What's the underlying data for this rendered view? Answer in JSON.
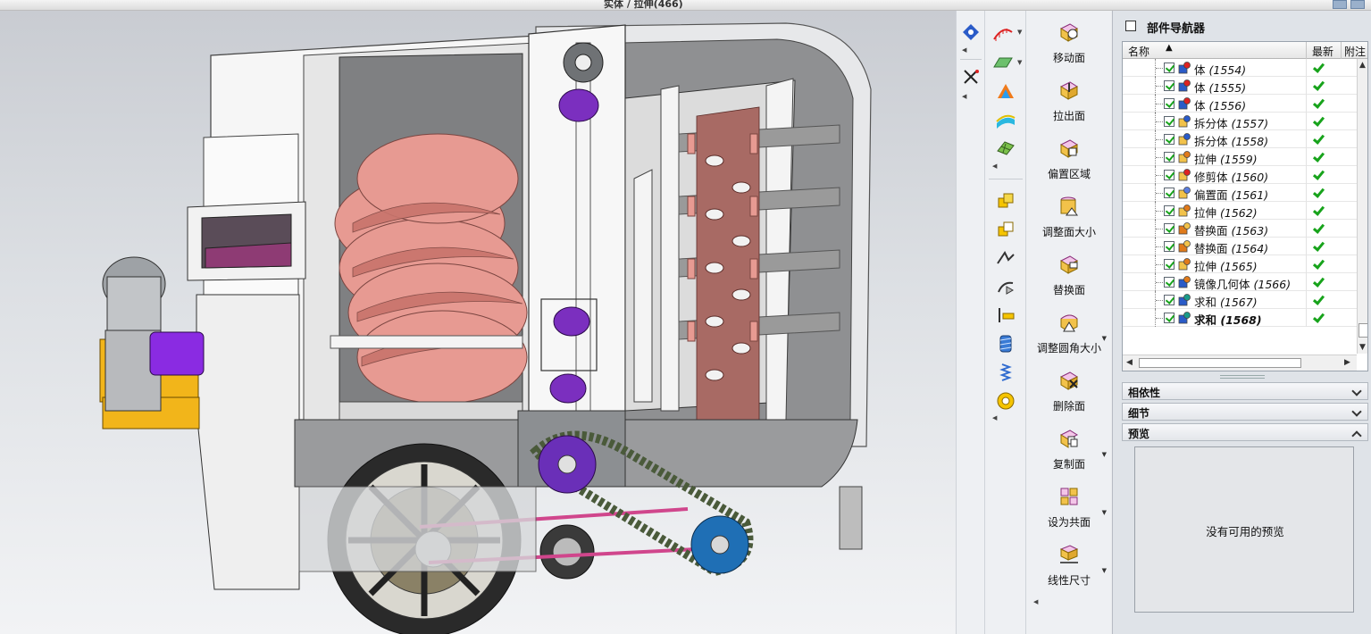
{
  "window": {
    "title": "实体 / 拉伸(466)"
  },
  "commands": [
    {
      "label": "移动面",
      "dropdown": false
    },
    {
      "label": "拉出面",
      "dropdown": false
    },
    {
      "label": "偏置区域",
      "dropdown": false
    },
    {
      "label": "调整面大小",
      "dropdown": false
    },
    {
      "label": "替换面",
      "dropdown": false
    },
    {
      "label": "调整圆角大小",
      "dropdown": true
    },
    {
      "label": "删除面",
      "dropdown": false
    },
    {
      "label": "复制面",
      "dropdown": true
    },
    {
      "label": "设为共面",
      "dropdown": true
    },
    {
      "label": "线性尺寸",
      "dropdown": true
    }
  ],
  "navigator": {
    "title": "部件导航器",
    "columns": {
      "name": "名称",
      "latest": "最新",
      "attach": "附注"
    },
    "rows": [
      {
        "name": "体",
        "id": "(1554)",
        "icon": "body-icon",
        "latest": true
      },
      {
        "name": "体",
        "id": "(1555)",
        "icon": "body-icon",
        "latest": true
      },
      {
        "name": "体",
        "id": "(1556)",
        "icon": "body-icon",
        "latest": true
      },
      {
        "name": "拆分体",
        "id": "(1557)",
        "icon": "split-body-icon",
        "latest": true
      },
      {
        "name": "拆分体",
        "id": "(1558)",
        "icon": "split-body-icon",
        "latest": true
      },
      {
        "name": "拉伸",
        "id": "(1559)",
        "icon": "extrude-icon",
        "latest": true
      },
      {
        "name": "修剪体",
        "id": "(1560)",
        "icon": "trim-body-icon",
        "latest": true
      },
      {
        "name": "偏置面",
        "id": "(1561)",
        "icon": "offset-face-icon",
        "latest": true
      },
      {
        "name": "拉伸",
        "id": "(1562)",
        "icon": "extrude-icon",
        "latest": true
      },
      {
        "name": "替换面",
        "id": "(1563)",
        "icon": "replace-face-icon",
        "latest": true
      },
      {
        "name": "替换面",
        "id": "(1564)",
        "icon": "replace-face-icon",
        "latest": true
      },
      {
        "name": "拉伸",
        "id": "(1565)",
        "icon": "extrude-icon",
        "latest": true
      },
      {
        "name": "镜像几何体",
        "id": "(1566)",
        "icon": "mirror-geometry-icon",
        "latest": true
      },
      {
        "name": "求和",
        "id": "(1567)",
        "icon": "unite-icon",
        "latest": true
      },
      {
        "name": "求和",
        "id": "(1568)",
        "icon": "unite-icon",
        "latest": true
      }
    ],
    "panels": {
      "dependencies": "相依性",
      "details": "细节",
      "preview": "预览"
    },
    "preview_message": "没有可用的预览"
  },
  "colors": {
    "viewport_top": "#c9ccd2",
    "viewport_bottom": "#f2f3f5",
    "check_green": "#17a31b",
    "gear_purple": "#7b2fbf",
    "screw_salmon": "#e79a92",
    "chain_green": "#4a5a3a",
    "sprocket_blue": "#1f6fb5",
    "motor_purple": "#8a2be2",
    "base_yellow": "#f2b51a"
  }
}
